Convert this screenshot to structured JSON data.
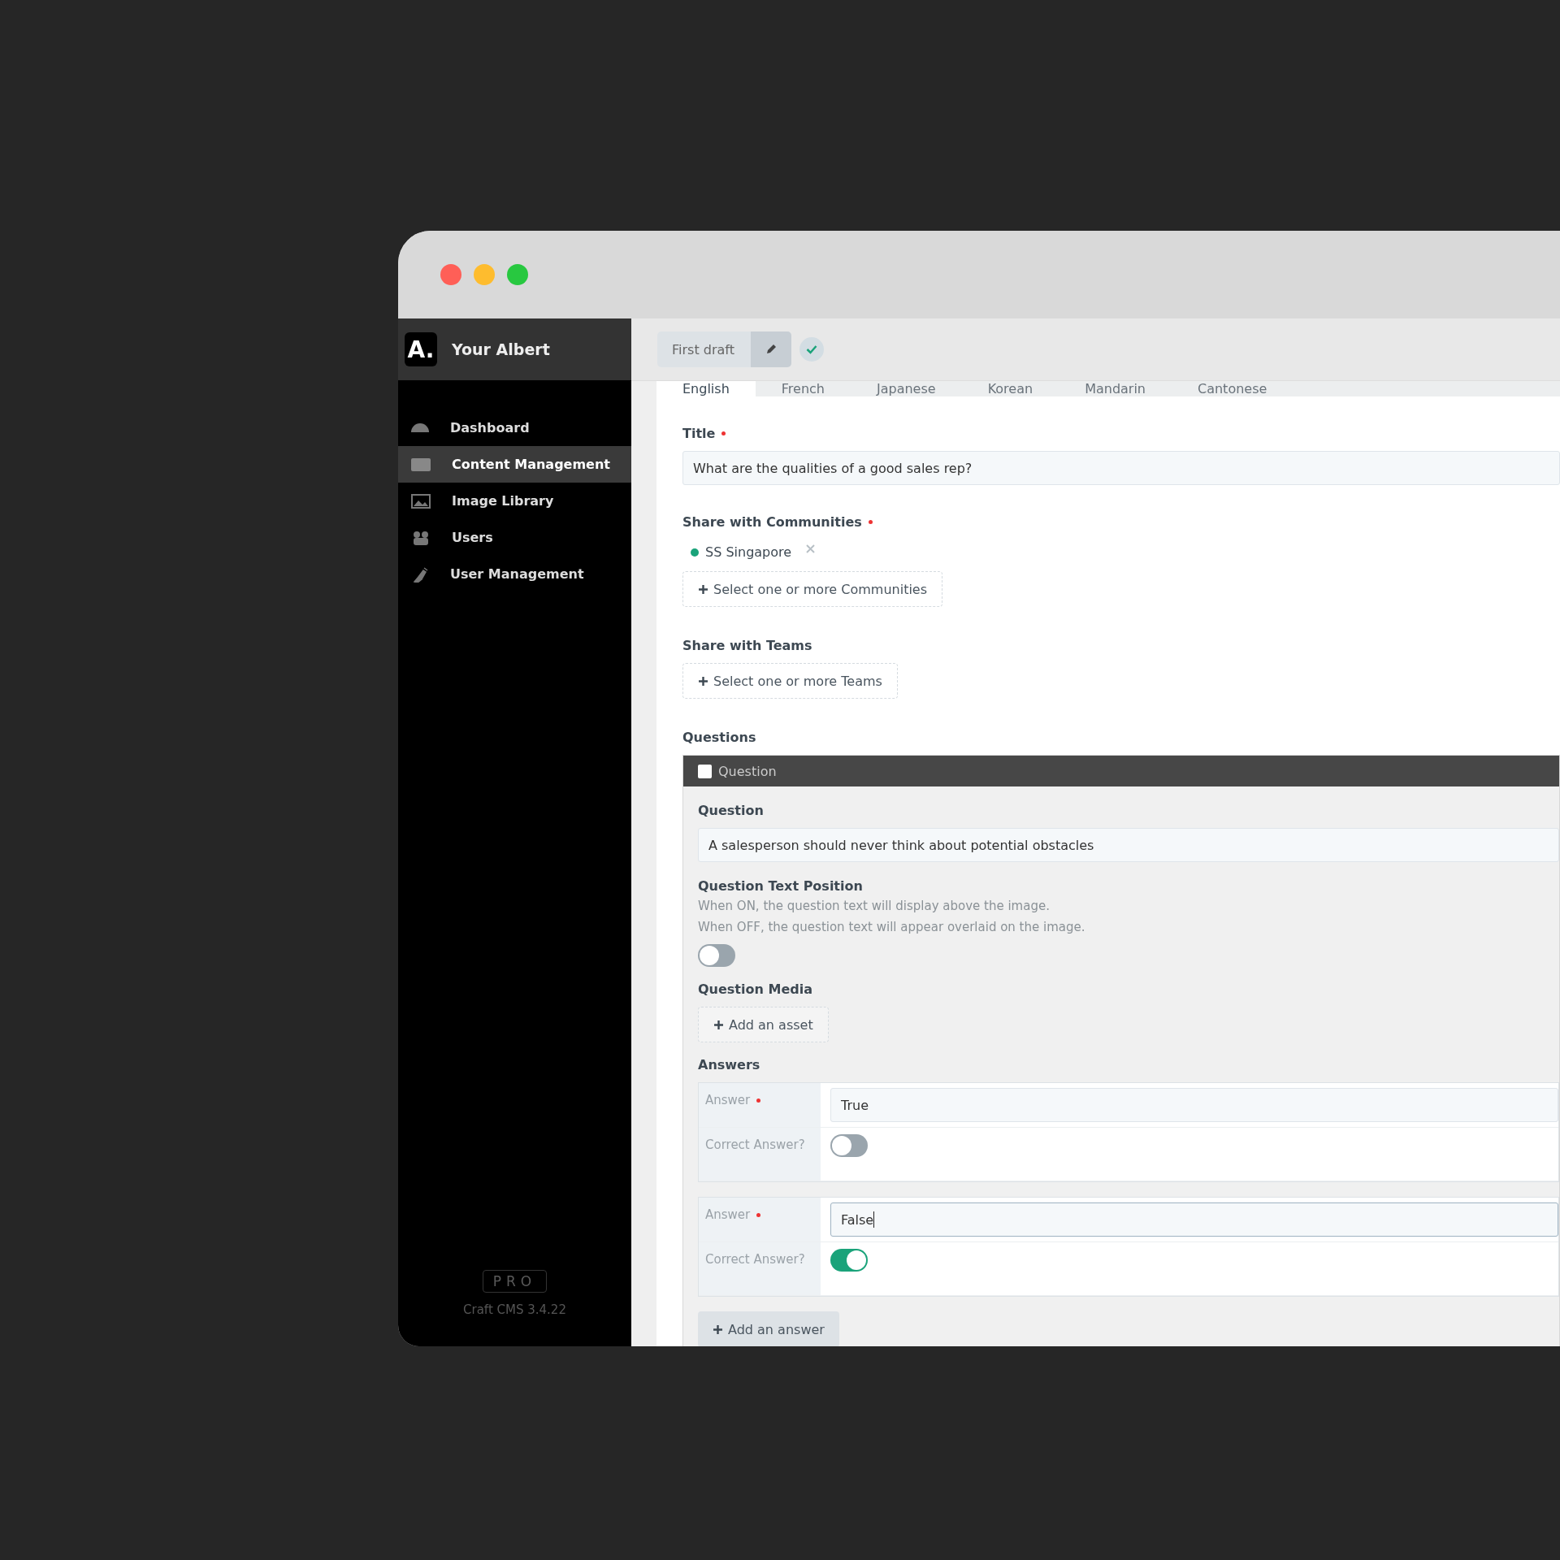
{
  "sidebar": {
    "logo": "A.",
    "brand": "Your Albert",
    "items": [
      {
        "label": "Dashboard",
        "selected": false
      },
      {
        "label": "Content Management",
        "selected": true
      },
      {
        "label": "Image Library",
        "selected": false
      },
      {
        "label": "Users",
        "selected": false
      },
      {
        "label": "User Management",
        "selected": false
      }
    ],
    "badge": "PRO",
    "version": "Craft CMS 3.4.22"
  },
  "toolbar": {
    "draft": "First draft"
  },
  "tabs": [
    {
      "label": "English",
      "selected": true
    },
    {
      "label": "French",
      "selected": false
    },
    {
      "label": "Japanese",
      "selected": false
    },
    {
      "label": "Korean",
      "selected": false
    },
    {
      "label": "Mandarin",
      "selected": false
    },
    {
      "label": "Cantonese",
      "selected": false
    }
  ],
  "title_field": {
    "label": "Title",
    "required": true,
    "value": "What are the qualities of a good sales rep?"
  },
  "communities": {
    "label": "Share with Communities",
    "required": true,
    "tags": [
      {
        "label": "SS Singapore",
        "color": "#1aa37a"
      }
    ],
    "button": "Select one or more Communities"
  },
  "teams": {
    "label": "Share with Teams",
    "required": false,
    "button": "Select one or more Teams"
  },
  "questions": {
    "label": "Questions",
    "block": {
      "header": "Question",
      "checked": false,
      "question_label": "Question",
      "question_value": "A salesperson should never think about potential obstacles",
      "position_label": "Question Text Position",
      "position_help": [
        "When ON, the question text will display above the image.",
        "When OFF, the question text will appear overlaid on the image."
      ],
      "position_on": false,
      "media_label": "Question Media",
      "media_button": "Add an asset",
      "answers_label": "Answers",
      "answers": [
        {
          "label": "Answer",
          "required": true,
          "value": "True",
          "focused": false,
          "correct_label": "Correct Answer?",
          "correct": false
        },
        {
          "label": "Answer",
          "required": true,
          "value": "False",
          "focused": true,
          "correct_label": "Correct Answer?",
          "correct": true
        }
      ],
      "add_button": "Add an answer"
    }
  }
}
